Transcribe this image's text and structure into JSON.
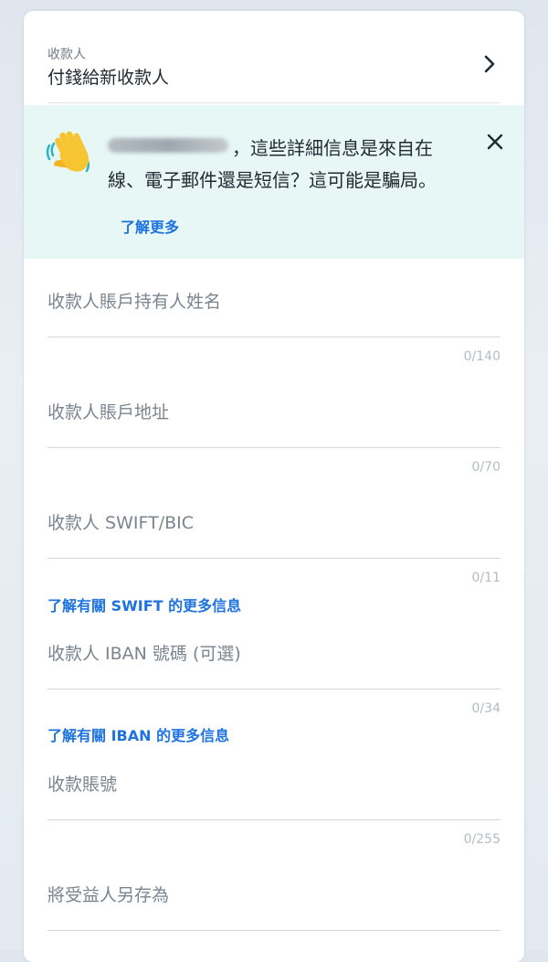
{
  "payee": {
    "caption": "收款人",
    "value": "付錢給新收款人"
  },
  "alert": {
    "line1": "，這些詳細信息是來自在",
    "line2": "線、電子郵件還是短信？這可能是騙局。",
    "learn_more": "了解更多"
  },
  "fields": [
    {
      "placeholder": "收款人賬戶持有人姓名",
      "counter": "0/140"
    },
    {
      "placeholder": "收款人賬戶地址",
      "counter": "0/70"
    },
    {
      "placeholder": "收款人 SWIFT/BIC",
      "counter": "0/11"
    },
    {
      "placeholder": "收款人 IBAN 號碼 (可選)",
      "counter": "0/34"
    },
    {
      "placeholder": "收款賬號",
      "counter": "0/255"
    },
    {
      "placeholder": "將受益人另存為",
      "counter": ""
    }
  ],
  "links": {
    "swift_info": "了解有關 SWIFT 的更多信息",
    "iban_info": "了解有關 IBAN 的更多信息"
  },
  "colors": {
    "accent": "#1e73e0",
    "alert_bg": "#e6f7f6"
  },
  "icons": {
    "chevron": "chevron-right-icon",
    "close": "close-icon",
    "wave": "waving-hand-icon"
  }
}
